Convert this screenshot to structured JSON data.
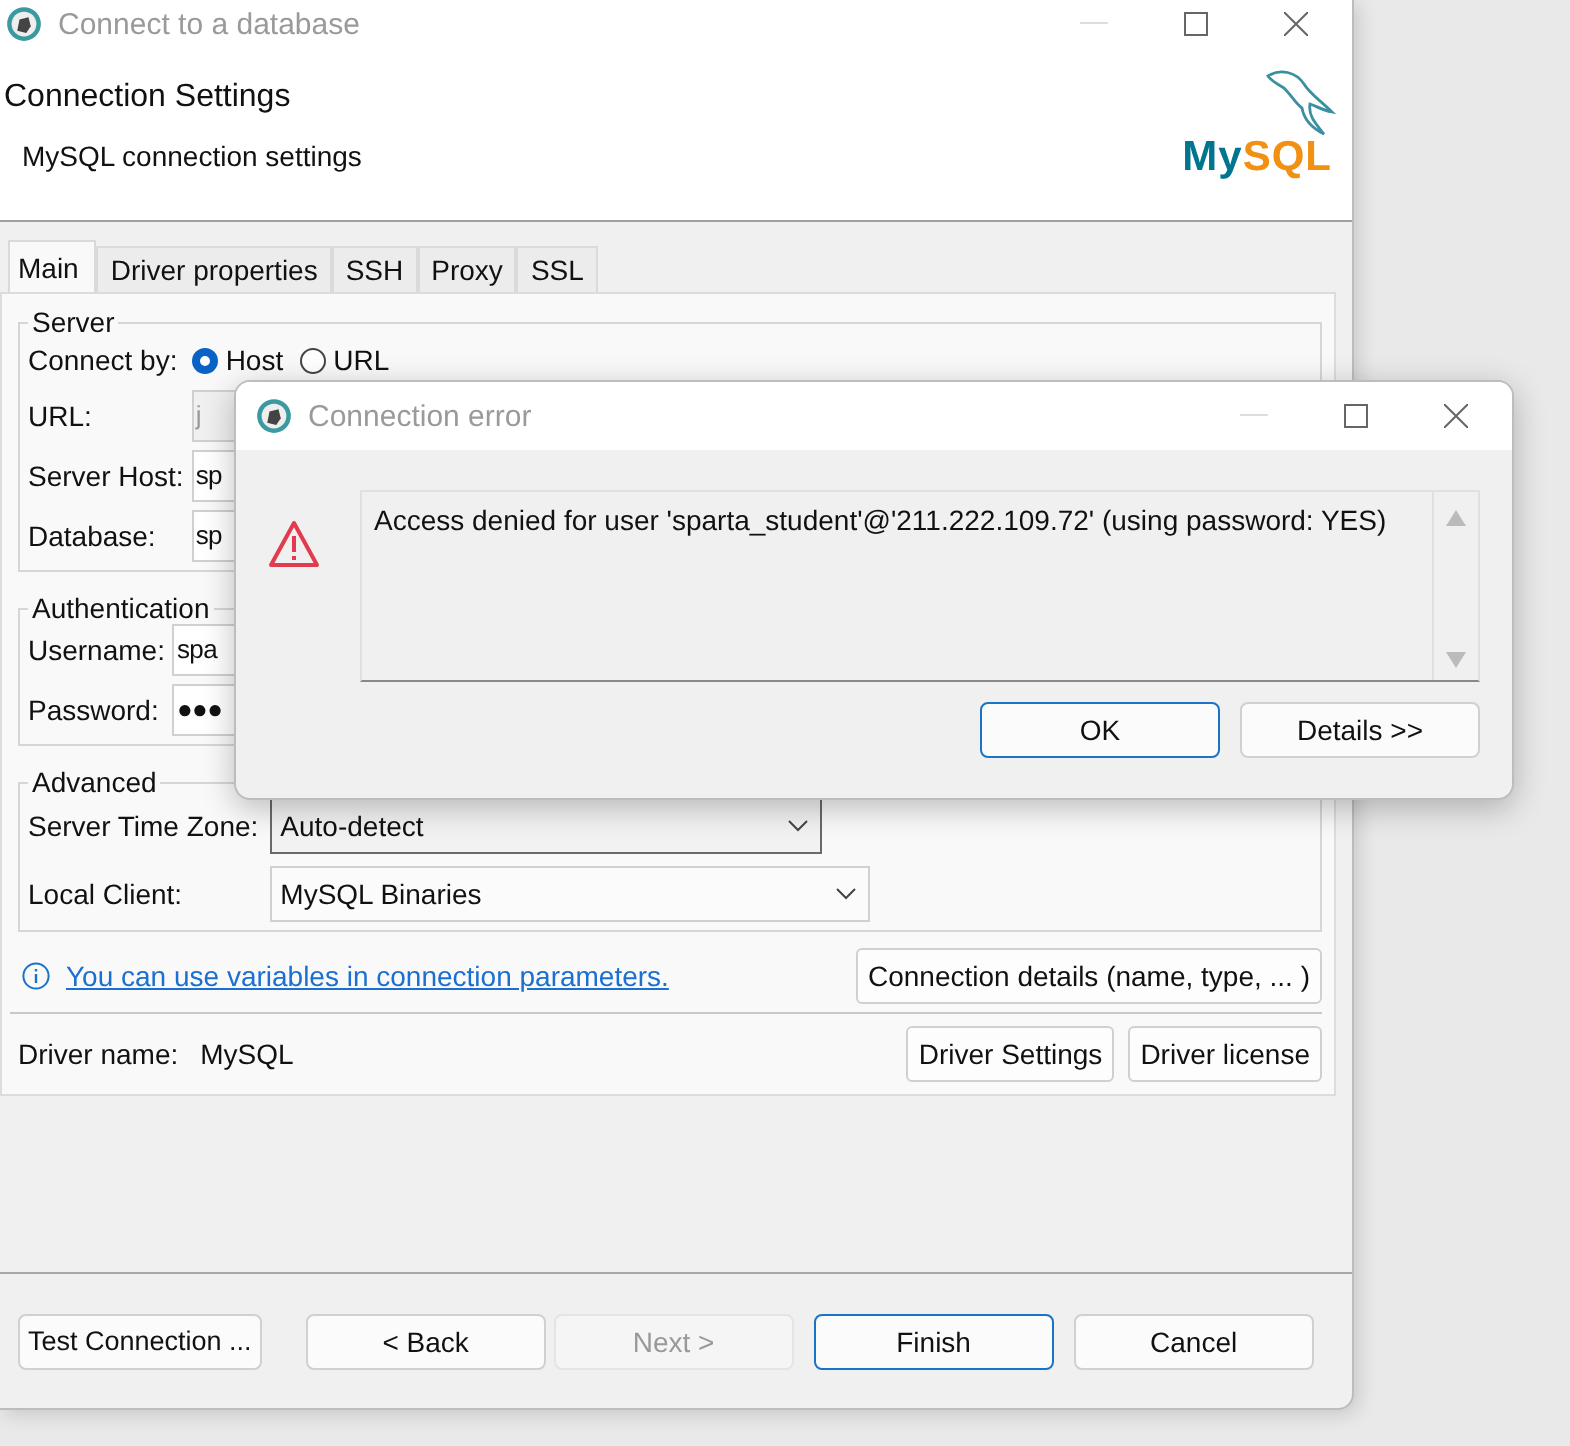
{
  "window": {
    "title": "Connect to a database"
  },
  "header": {
    "title": "Connection Settings",
    "subtitle": "MySQL connection settings",
    "logo": [
      "My",
      "SQL"
    ]
  },
  "tabs": [
    {
      "label": "Main",
      "selected": true
    },
    {
      "label": "Driver properties",
      "selected": false
    },
    {
      "label": "SSH",
      "selected": false
    },
    {
      "label": "Proxy",
      "selected": false
    },
    {
      "label": "SSL",
      "selected": false
    }
  ],
  "server": {
    "legend": "Server",
    "connect_by": {
      "label": "Connect by:",
      "options": [
        {
          "label": "Host",
          "selected": true
        },
        {
          "label": "URL",
          "selected": false
        }
      ]
    },
    "fields": [
      {
        "label": "URL:",
        "value": "j",
        "disabled": true
      },
      {
        "label": "Server Host:",
        "value": "sp",
        "disabled": false
      },
      {
        "label": "Database:",
        "value": "sp",
        "disabled": false
      }
    ]
  },
  "authentication": {
    "legend": "Authentication",
    "fields": [
      {
        "label": "Username:",
        "value": "spa",
        "disabled": false
      },
      {
        "label": "Password:",
        "value": "●●●",
        "disabled": false
      }
    ]
  },
  "advanced": {
    "legend": "Advanced",
    "selects": [
      {
        "label": "Server Time Zone:",
        "value": "Auto-detect",
        "focused": true
      },
      {
        "label": "Local Client:",
        "value": "MySQL Binaries",
        "focused": false
      }
    ]
  },
  "info_link": "You can use variables in connection parameters.",
  "connection_details_button": "Connection details (name, type, ... )",
  "driver": {
    "label": "Driver name:",
    "value": "MySQL",
    "buttons": [
      "Driver Settings",
      "Driver license"
    ]
  },
  "footer_buttons": [
    {
      "label": "Test Connection ...",
      "disabled": false,
      "default": false
    },
    {
      "label": "< Back",
      "disabled": false,
      "default": false
    },
    {
      "label": "Next >",
      "disabled": true,
      "default": false
    },
    {
      "label": "Finish",
      "disabled": false,
      "default": true
    },
    {
      "label": "Cancel",
      "disabled": false,
      "default": false
    }
  ],
  "dialog": {
    "title": "Connection error",
    "message": "Access denied for user 'sparta_student'@'211.222.109.72' (using password: YES)",
    "buttons": [
      {
        "label": "OK",
        "default": true
      },
      {
        "label": "Details >>",
        "default": false
      }
    ]
  }
}
